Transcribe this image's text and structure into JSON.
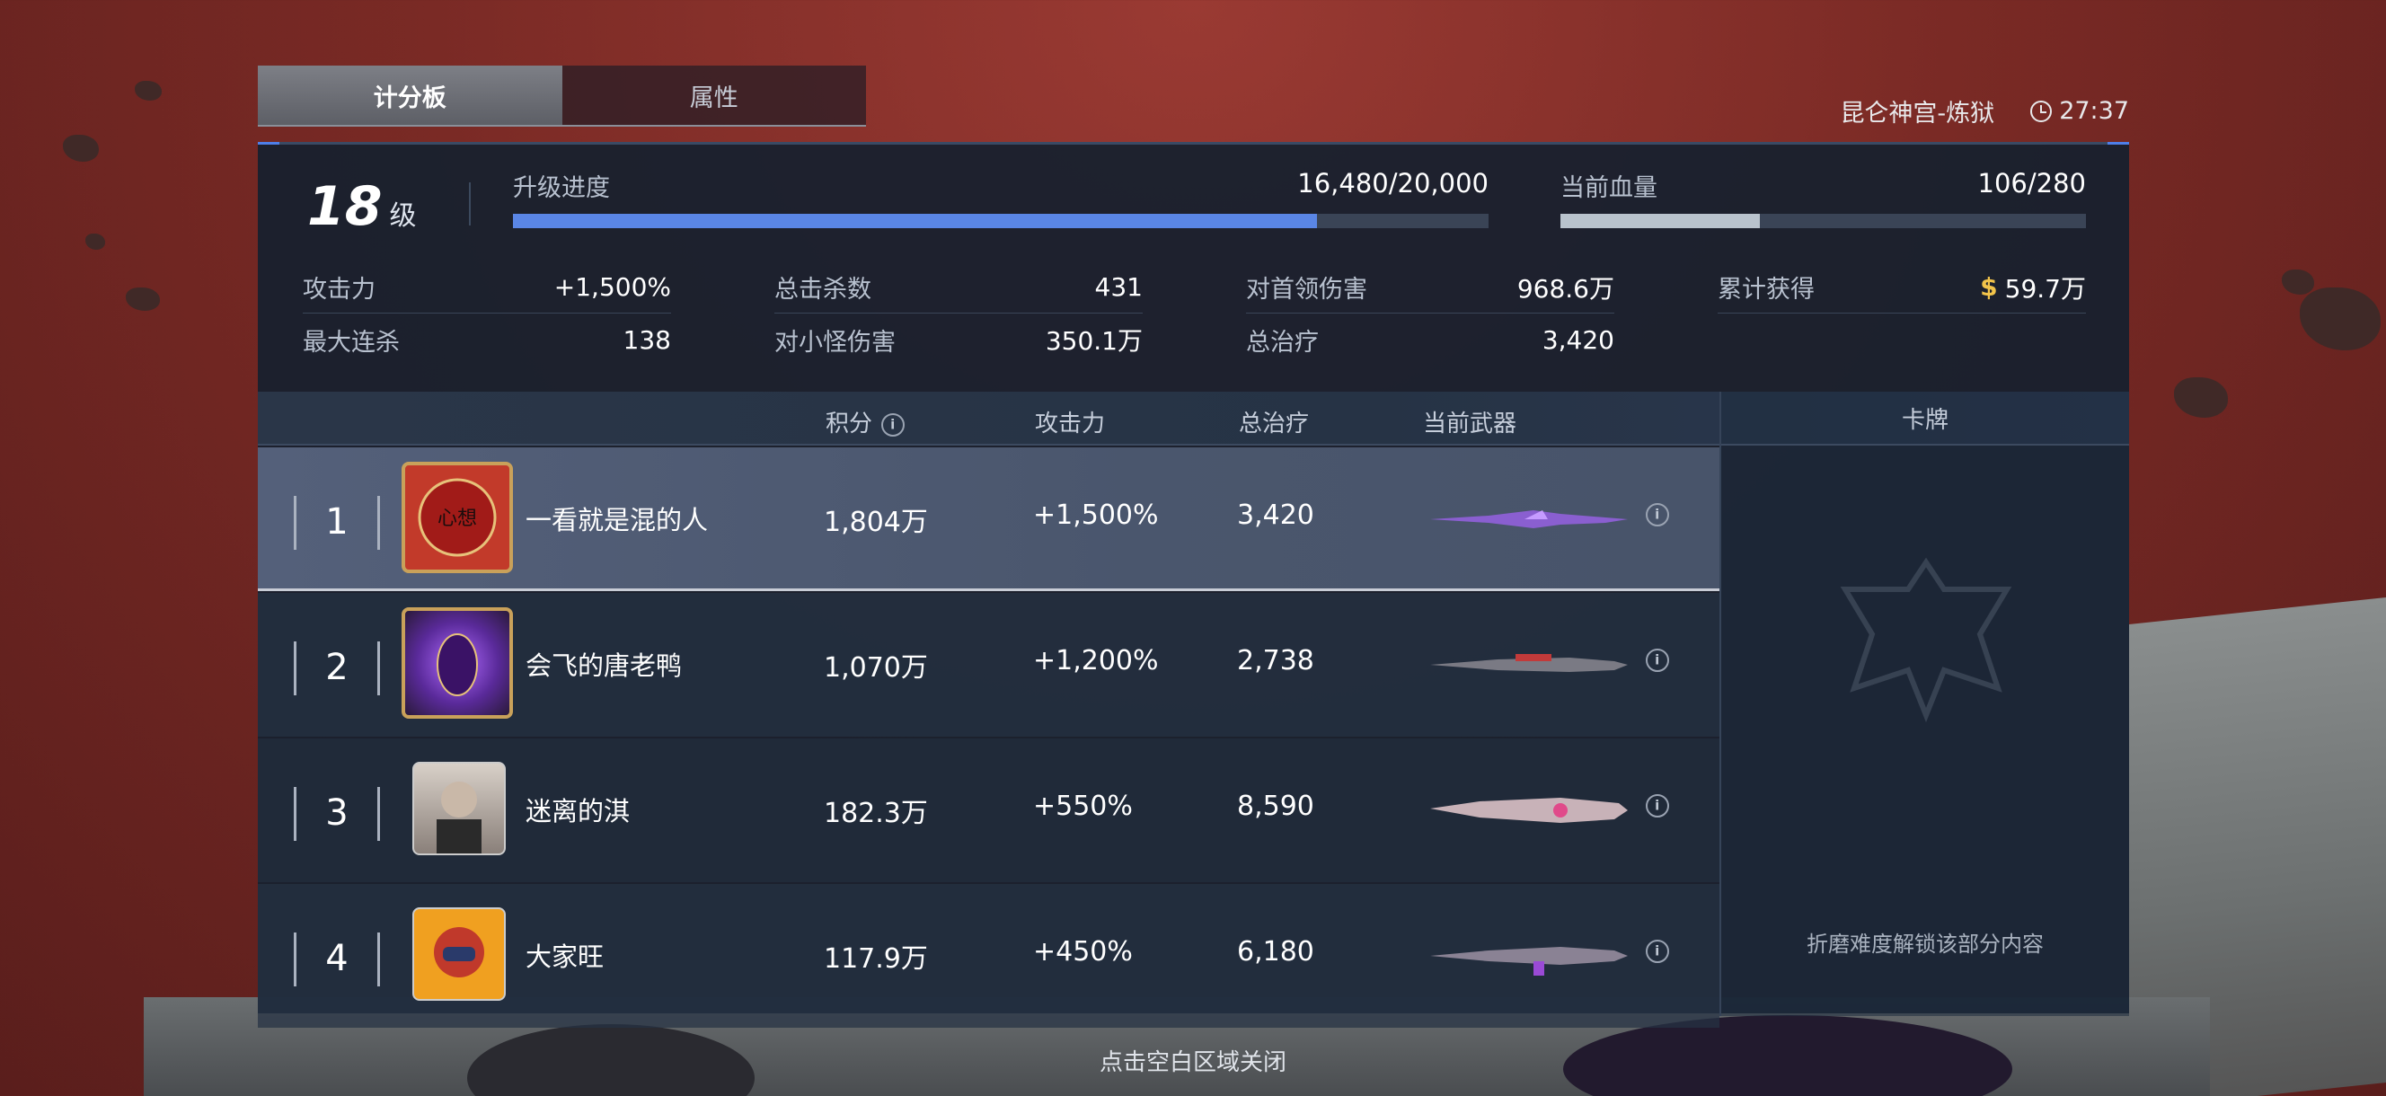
{
  "tabs": [
    {
      "label": "计分板",
      "active": true
    },
    {
      "label": "属性",
      "active": false
    }
  ],
  "location": "昆仑神宫-炼狱",
  "timer": "27:37",
  "summary": {
    "level": "18",
    "level_unit": "级",
    "upgrade": {
      "label": "升级进度",
      "value": "16,480/20,000",
      "progress": 0.824,
      "color": "#5a86e6"
    },
    "hp": {
      "label": "当前血量",
      "value": "106/280",
      "progress": 0.379,
      "color": "#b9c3cd"
    },
    "stats": [
      {
        "key": "攻击力",
        "value": "+1,500%"
      },
      {
        "key": "总击杀数",
        "value": "431"
      },
      {
        "key": "对首领伤害",
        "value": "968.6万"
      },
      {
        "key": "累计获得",
        "value": "59.7万",
        "currency_symbol": "$"
      },
      {
        "key": "最大连杀",
        "value": "138"
      },
      {
        "key": "对小怪伤害",
        "value": "350.1万"
      },
      {
        "key": "总治疗",
        "value": "3,420"
      }
    ]
  },
  "table": {
    "headers": {
      "score": "积分",
      "attack": "攻击力",
      "heal": "总治疗",
      "weapon": "当前武器",
      "card": "卡牌"
    },
    "rows": [
      {
        "rank": "1",
        "name": "一看就是混的人",
        "score": "1,804万",
        "attack": "+1,500%",
        "heal": "3,420",
        "weapon_icon": "purple-rifle-icon",
        "avatar_icon": "red-seal-avatar-icon"
      },
      {
        "rank": "2",
        "name": "会飞的唐老鸭",
        "score": "1,070万",
        "attack": "+1,200%",
        "heal": "2,738",
        "weapon_icon": "red-rifle-icon",
        "avatar_icon": "purple-crystal-avatar-icon"
      },
      {
        "rank": "3",
        "name": "迷离的淇",
        "score": "182.3万",
        "attack": "+550%",
        "heal": "8,590",
        "weapon_icon": "pink-rifle-icon",
        "avatar_icon": "girl-portrait-avatar-icon"
      },
      {
        "rank": "4",
        "name": "大家旺",
        "score": "117.9万",
        "attack": "+450%",
        "heal": "6,180",
        "weapon_icon": "violet-rifle-icon",
        "avatar_icon": "robot-avatar-icon"
      }
    ],
    "card_locked_text": "折磨难度解锁该部分内容"
  },
  "close_hint": "点击空白区域关闭",
  "colors": {
    "accent_blue": "#4f7fe8",
    "gold": "#f2c44a"
  }
}
